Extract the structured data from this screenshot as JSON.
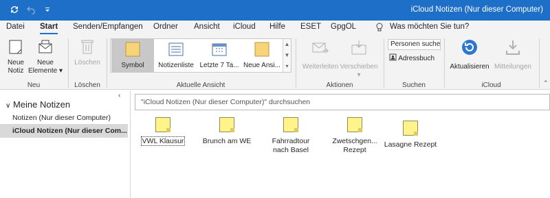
{
  "window": {
    "title": "iCloud Notizen (Nur dieser Computer)"
  },
  "colors": {
    "accent": "#1e6fc8",
    "note_yellow": "#fff38a"
  },
  "menu": {
    "tabs": [
      "Datei",
      "Start",
      "Senden/Empfangen",
      "Ordner",
      "Ansicht",
      "iCloud",
      "Hilfe",
      "ESET",
      "GpgOL"
    ],
    "active": "Start",
    "tellme": "Was möchten Sie tun?"
  },
  "ribbon": {
    "groups": {
      "neu": {
        "label": "Neu",
        "new_note_line1": "Neue",
        "new_note_line2": "Notiz",
        "new_items_line1": "Neue",
        "new_items_line2": "Elemente"
      },
      "loeschen": {
        "label": "Löschen",
        "delete": "Löschen"
      },
      "ansicht": {
        "label": "Aktuelle Ansicht",
        "items": [
          "Symbol",
          "Notizenliste",
          "Letzte 7 Ta...",
          "Neue Ansi..."
        ],
        "selected": "Symbol"
      },
      "aktionen": {
        "label": "Aktionen",
        "forward": "Weiterleiten",
        "move": "Verschieben"
      },
      "suchen": {
        "label": "Suchen",
        "search_people": "Personen suchen",
        "address_book": "Adressbuch"
      },
      "icloud": {
        "label": "iCloud",
        "refresh": "Aktualisieren",
        "updates": "Mitteilungen"
      }
    }
  },
  "nav": {
    "header": "Meine Notizen",
    "items": [
      {
        "label": "Notizen (Nur dieser Computer)",
        "selected": false
      },
      {
        "label": "iCloud Notizen (Nur dieser Com...",
        "selected": true
      }
    ]
  },
  "search": {
    "placeholder": "\"iCloud Notizen (Nur dieser Computer)\" durchsuchen"
  },
  "notes": [
    {
      "title": "VWL Klausur",
      "selected": true
    },
    {
      "title": "Brunch am WE",
      "selected": false
    },
    {
      "title": "Fahrradtour nach Basel",
      "selected": false
    },
    {
      "title": "Zwetschgen... Rezept",
      "selected": false
    },
    {
      "title": "Lasagne Rezept",
      "selected": false
    }
  ]
}
